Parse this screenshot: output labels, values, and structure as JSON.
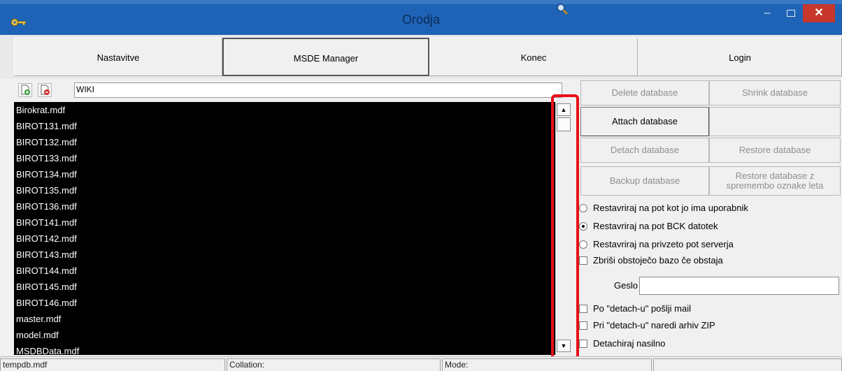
{
  "window": {
    "title": "Orodja",
    "minimize_glyph": "–",
    "close_glyph": "✕"
  },
  "nav": {
    "tabs": [
      {
        "label": "Nastavitve"
      },
      {
        "label": "MSDE Manager"
      },
      {
        "label": "Konec"
      },
      {
        "label": "Login"
      }
    ]
  },
  "toolbar": {
    "search_value": "WIKI"
  },
  "files": [
    "Birokrat.mdf",
    "BIROT131.mdf",
    "BIROT132.mdf",
    "BIROT133.mdf",
    "BIROT134.mdf",
    "BIROT135.mdf",
    "BIROT136.mdf",
    "BIROT141.mdf",
    "BIROT142.mdf",
    "BIROT143.mdf",
    "BIROT144.mdf",
    "BIROT145.mdf",
    "BIROT146.mdf",
    "master.mdf",
    "model.mdf",
    "MSDBData.mdf"
  ],
  "scroll": {
    "up_glyph": "▲",
    "down_glyph": "▼"
  },
  "actions": {
    "delete": "Delete database",
    "shrink": "Shrink database",
    "attach": "Attach database",
    "detach": "Detach database",
    "restore": "Restore database",
    "backup": "Backup database",
    "restore_change_line1": "Restore database z",
    "restore_change_line2": "spremembo oznake leta"
  },
  "options": {
    "radio1": "Restavriraj na pot kot jo ima uporabnik",
    "radio2": "Restavriraj na pot BCK datotek",
    "radio3": "Restavriraj na privzeto pot serverja",
    "check_delete": "Zbriši obstoječo bazo če obstaja",
    "password_label": "Geslo",
    "check_mail": "Po \"detach-u\" pošlji mail",
    "check_zip": "Pri \"detach-u\" naredi arhiv ZIP",
    "check_force": "Detachiraj nasilno"
  },
  "status": {
    "file": "tempdb.mdf",
    "collation": "Collation:",
    "mode": "Mode:"
  }
}
